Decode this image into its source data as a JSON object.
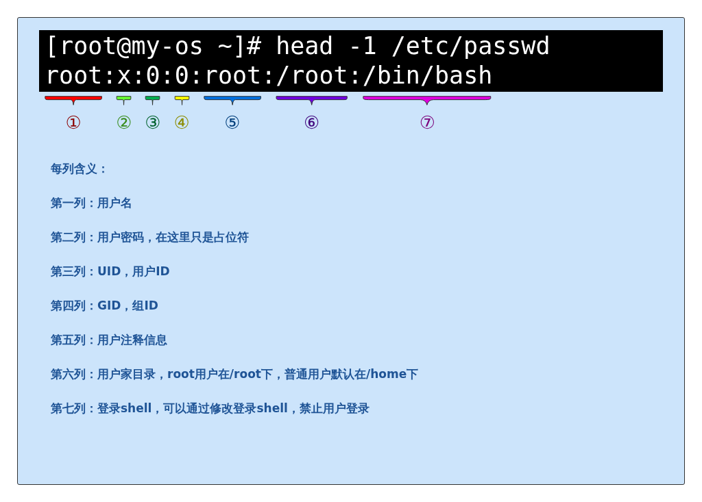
{
  "terminal": {
    "command_line": "[root@my-os ~]# head -1 /etc/passwd",
    "output_parts": [
      {
        "text": "root",
        "marker": "①",
        "color": "#ff0000"
      },
      {
        "text": ":"
      },
      {
        "text": "x",
        "marker": "②",
        "color": "#66ff33"
      },
      {
        "text": ":"
      },
      {
        "text": "0",
        "marker": "③",
        "color": "#00b050"
      },
      {
        "text": ":"
      },
      {
        "text": "0",
        "marker": "④",
        "color": "#ffff00"
      },
      {
        "text": ":"
      },
      {
        "text": "root",
        "marker": "⑤",
        "color": "#0070e0"
      },
      {
        "text": ":"
      },
      {
        "text": "/root",
        "marker": "⑥",
        "color": "#7000e0"
      },
      {
        "text": ":"
      },
      {
        "text": "/bin/bash",
        "marker": "⑦",
        "color": "#e000e0"
      }
    ]
  },
  "notes": {
    "heading": "每列含义：",
    "items": [
      "第一列：用户名",
      "第二列：用户密码，在这里只是占位符",
      "第三列：UID，用户ID",
      "第四列：GID，组ID",
      "第五列：用户注释信息",
      "第六列：用户家目录，root用户在/root下，普通用户默认在/home下",
      "第七列：登录shell，可以通过修改登录shell，禁止用户登录"
    ]
  }
}
